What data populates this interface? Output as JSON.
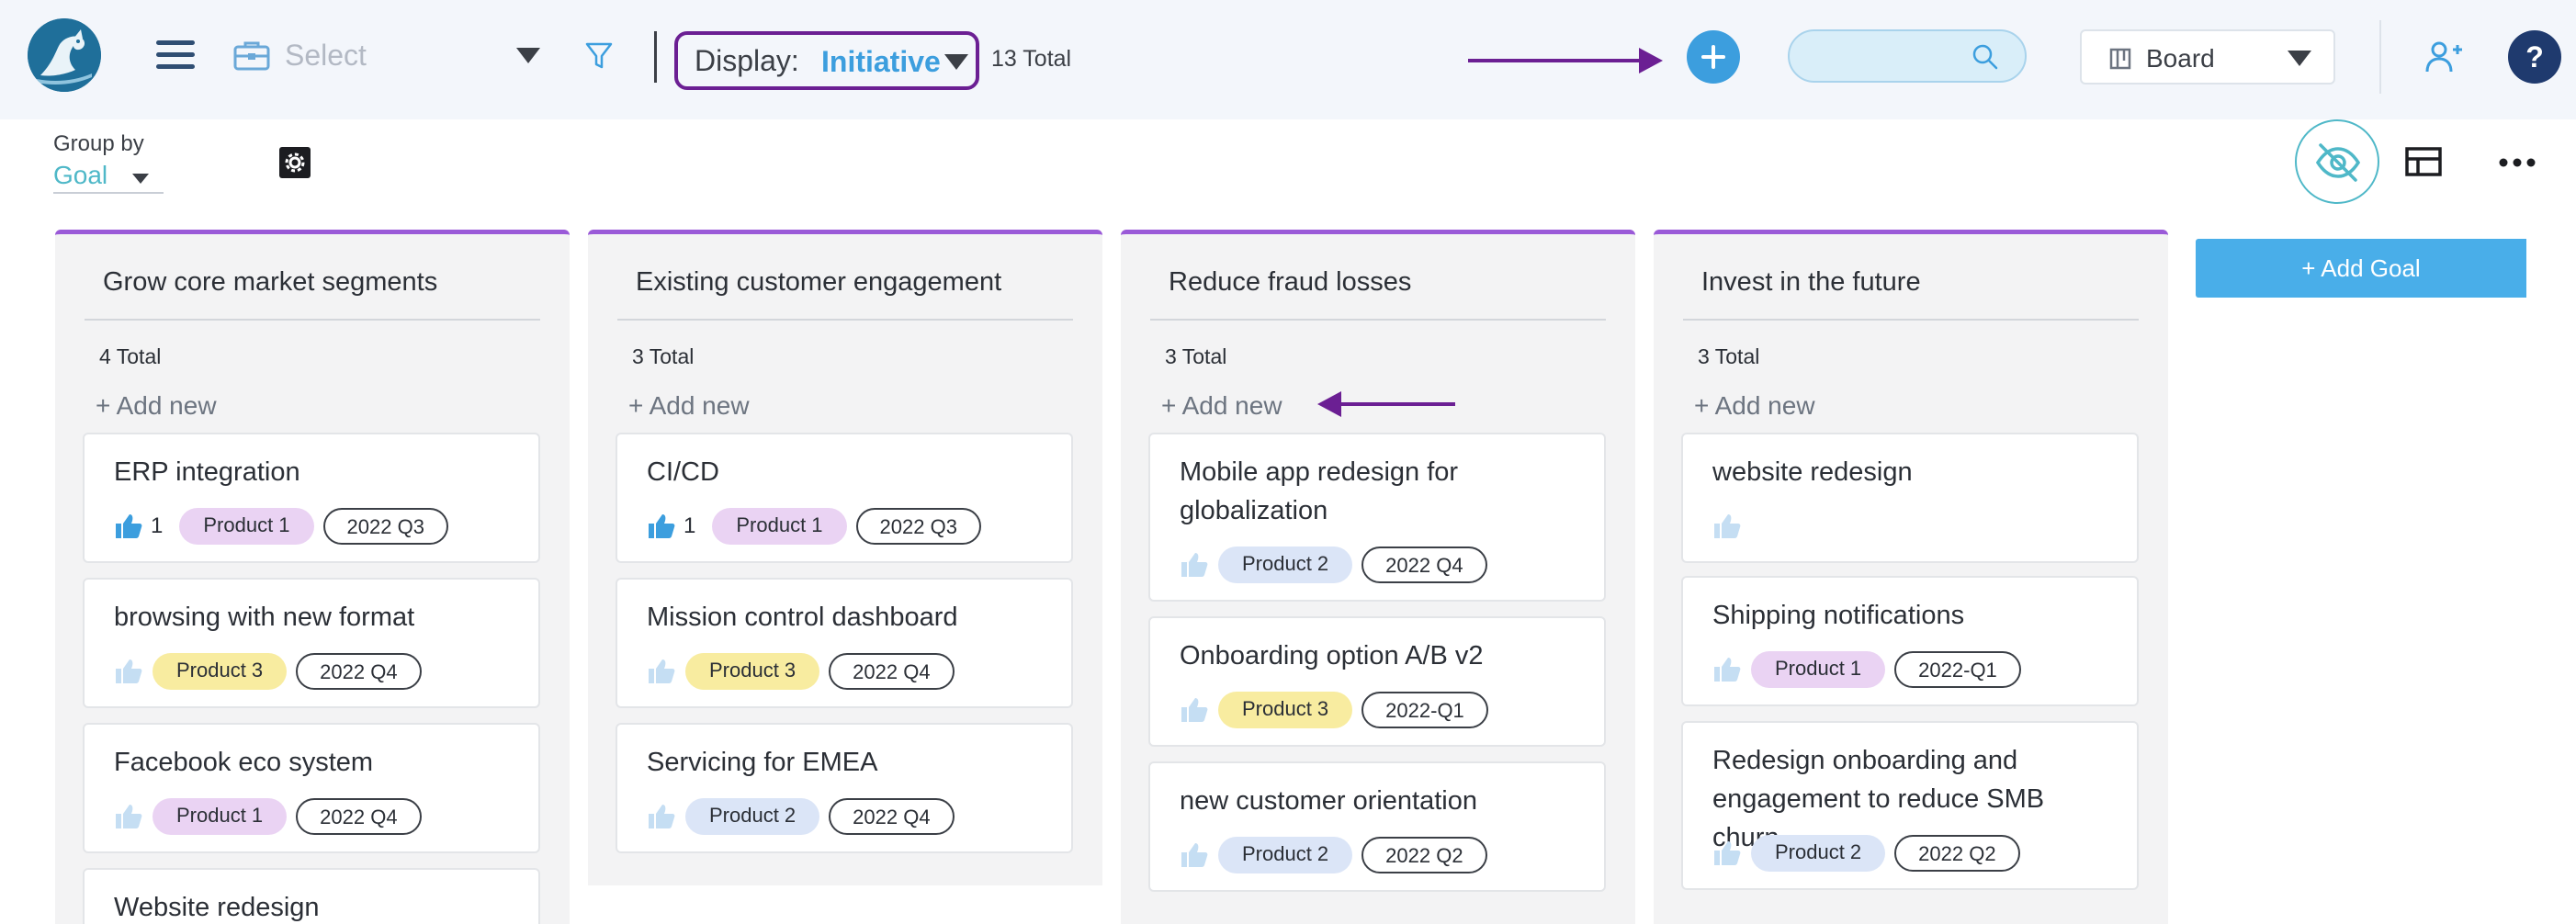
{
  "toolbar": {
    "select_label": "Select",
    "display_label": "Display:",
    "display_value": "Initiative",
    "total": "13 Total",
    "search_placeholder": "",
    "view_label": "Board",
    "help_label": "?"
  },
  "subbar": {
    "group_by_label": "Group by",
    "group_by_value": "Goal"
  },
  "add_goal_label": "+ Add Goal",
  "add_new_label": "+ Add new",
  "colors": {
    "accent": "#3c9ede",
    "annotation": "#6b1f93",
    "column_border": "#9a5ad8",
    "product1": "#ead3f3",
    "product2": "#dbe5f7",
    "product3": "#f8eca0"
  },
  "columns": [
    {
      "title": "Grow core market segments",
      "total": "4 Total",
      "cards": [
        {
          "title": "ERP integration",
          "likes": "1",
          "product": "Product 1",
          "date": "2022 Q3"
        },
        {
          "title": "browsing with new format",
          "likes": "",
          "product": "Product 3",
          "date": "2022 Q4"
        },
        {
          "title": "Facebook eco system",
          "likes": "",
          "product": "Product 1",
          "date": "2022 Q4"
        },
        {
          "title": "Website redesign",
          "likes": "",
          "product": "",
          "date": ""
        }
      ]
    },
    {
      "title": "Existing customer engagement",
      "total": "3 Total",
      "cards": [
        {
          "title": "CI/CD",
          "likes": "1",
          "product": "Product 1",
          "date": "2022 Q3"
        },
        {
          "title": "Mission control dashboard",
          "likes": "",
          "product": "Product 3",
          "date": "2022 Q4"
        },
        {
          "title": "Servicing for EMEA",
          "likes": "",
          "product": "Product 2",
          "date": "2022 Q4"
        }
      ]
    },
    {
      "title": "Reduce fraud losses",
      "total": "3 Total",
      "cards": [
        {
          "title": "Mobile app redesign for globalization",
          "likes": "",
          "product": "Product 2",
          "date": "2022 Q4"
        },
        {
          "title": "Onboarding option A/B v2",
          "likes": "",
          "product": "Product 3",
          "date": "2022-Q1"
        },
        {
          "title": "new customer orientation",
          "likes": "",
          "product": "Product 2",
          "date": "2022 Q2"
        }
      ]
    },
    {
      "title": "Invest in the future",
      "total": "3 Total",
      "cards": [
        {
          "title": "website redesign",
          "likes": "",
          "product": "",
          "date": ""
        },
        {
          "title": "Shipping notifications",
          "likes": "",
          "product": "Product 1",
          "date": "2022-Q1"
        },
        {
          "title": "Redesign onboarding and engagement to reduce SMB churn",
          "likes": "",
          "product": "Product 2",
          "date": "2022 Q2"
        }
      ]
    }
  ]
}
